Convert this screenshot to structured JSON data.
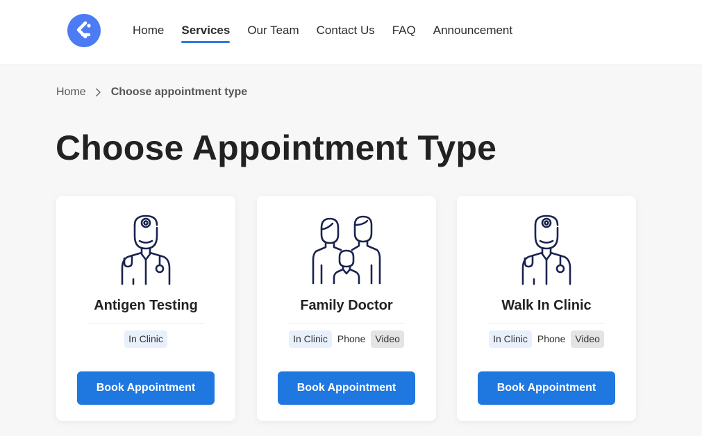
{
  "colors": {
    "logo_bg": "#4d7bf3",
    "accent": "#1f77e0",
    "icon_stroke": "#1a2350",
    "tag_clinic_bg": "#e8f0fc",
    "tag_video_bg": "#e4e4e4"
  },
  "nav": {
    "logo_icon": "brand-logo-icon",
    "items": [
      {
        "label": "Home",
        "active": false
      },
      {
        "label": "Services",
        "active": true
      },
      {
        "label": "Our Team",
        "active": false
      },
      {
        "label": "Contact Us",
        "active": false
      },
      {
        "label": "FAQ",
        "active": false
      },
      {
        "label": "Announcement",
        "active": false
      }
    ]
  },
  "breadcrumb": {
    "home": "Home",
    "separator_icon": "chevron-right-icon",
    "current": "Choose appointment type"
  },
  "page_title": "Choose Appointment Type",
  "cards": [
    {
      "title": "Antigen Testing",
      "icon": "doctor-icon",
      "tags": [
        "In Clinic"
      ],
      "button": "Book Appointment"
    },
    {
      "title": "Family Doctor",
      "icon": "family-icon",
      "tags": [
        "In Clinic",
        "Phone",
        "Video"
      ],
      "button": "Book Appointment"
    },
    {
      "title": "Walk In Clinic",
      "icon": "doctor-icon",
      "tags": [
        "In Clinic",
        "Phone",
        "Video"
      ],
      "button": "Book Appointment"
    }
  ]
}
